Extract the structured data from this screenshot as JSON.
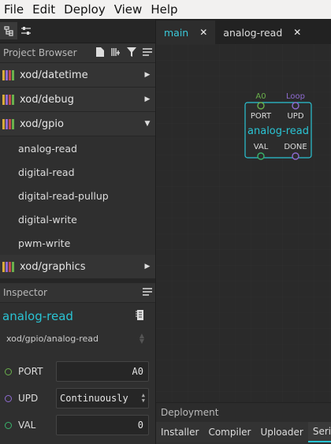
{
  "menu": [
    "File",
    "Edit",
    "Deploy",
    "View",
    "Help"
  ],
  "project_browser": {
    "title": "Project Browser",
    "libraries": [
      {
        "label": "xod/datetime",
        "state": "collapsed"
      },
      {
        "label": "xod/debug",
        "state": "collapsed"
      },
      {
        "label": "xod/gpio",
        "state": "expanded"
      },
      {
        "label": "xod/graphics",
        "state": "collapsed"
      }
    ],
    "gpio_nodes": [
      "analog-read",
      "digital-read",
      "digital-read-pullup",
      "digital-write",
      "pwm-write"
    ]
  },
  "inspector": {
    "title": "Inspector",
    "node_title": "analog-read",
    "node_path": "xod/gpio/analog-read",
    "pins": [
      {
        "name": "PORT",
        "value": "A0",
        "color": "#6ab04c"
      },
      {
        "name": "UPD",
        "value": "Continuously",
        "color": "#8e6bd1"
      },
      {
        "name": "VAL",
        "value": "0",
        "color": "#39b36b"
      }
    ]
  },
  "tabs": [
    {
      "label": "main",
      "active": true
    },
    {
      "label": "analog-read",
      "active": false
    }
  ],
  "canvas_node": {
    "title": "analog-read",
    "top_labels": [
      "A0",
      "Loop"
    ],
    "pin_names_top": [
      "PORT",
      "UPD"
    ],
    "pin_names_bottom": [
      "VAL",
      "DONE"
    ]
  },
  "deployment": {
    "title": "Deployment",
    "tabs": [
      "Installer",
      "Compiler",
      "Uploader",
      "Serial"
    ],
    "selected": "Serial"
  },
  "colors": {
    "accent": "#2ac4d4",
    "port_green": "#6ab04c",
    "upd_purple": "#8e6bd1"
  }
}
